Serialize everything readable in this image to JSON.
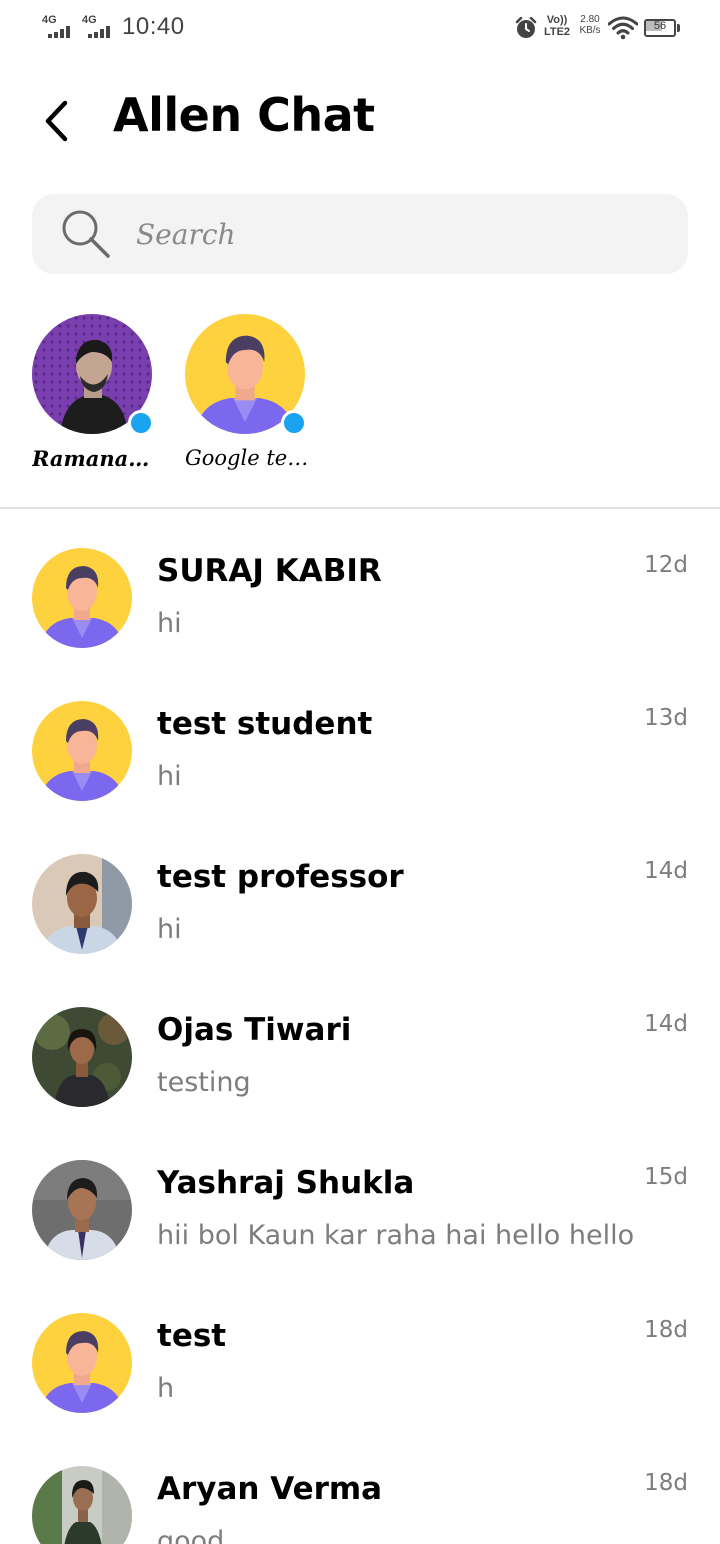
{
  "status_bar": {
    "sim1": "4G",
    "sim2": "4G",
    "time": "10:40",
    "volte_top": "Vo))",
    "volte_bottom": "LTE2",
    "speed_value": "2.80",
    "speed_unit": "KB/s",
    "battery": "56",
    "battery_level": 0.56
  },
  "header": {
    "title": "Allen Chat"
  },
  "search": {
    "placeholder": "Search"
  },
  "online_users": [
    {
      "name": "Ramanand ...",
      "avatar": "photo"
    },
    {
      "name": "Google tes...",
      "avatar": "default"
    }
  ],
  "chats": [
    {
      "name": "SURAJ KABIR",
      "message": "hi",
      "time": "12d",
      "avatar": "default"
    },
    {
      "name": "test student",
      "message": "hi",
      "time": "13d",
      "avatar": "default"
    },
    {
      "name": "test professor",
      "message": "hi",
      "time": "14d",
      "avatar": "photo"
    },
    {
      "name": "Ojas Tiwari",
      "message": "testing",
      "time": "14d",
      "avatar": "photo"
    },
    {
      "name": "Yashraj Shukla",
      "message": "hii bol Kaun kar raha hai hello hello",
      "time": "15d",
      "avatar": "photo"
    },
    {
      "name": "test",
      "message": "h",
      "time": "18d",
      "avatar": "default"
    },
    {
      "name": "Aryan Verma",
      "message": "good",
      "time": "18d",
      "avatar": "photo"
    }
  ],
  "colors": {
    "online_dot": "#1aa3f0",
    "default_avatar_bg": "#fdd23e",
    "default_avatar_shirt": "#7b68ee",
    "search_bg": "#f3f3f3",
    "muted_text": "#7d7d7d"
  }
}
